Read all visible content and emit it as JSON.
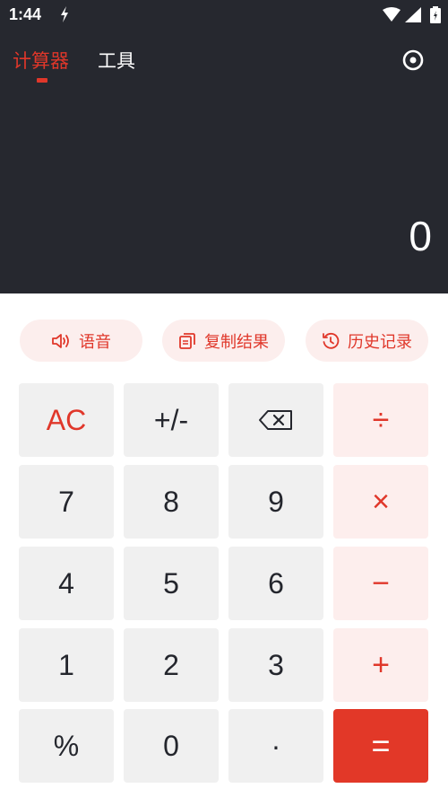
{
  "status": {
    "time": "1:44"
  },
  "tabs": {
    "calculator": "计算器",
    "tools": "工具"
  },
  "display": {
    "value": "0"
  },
  "actions": {
    "voice": "语音",
    "copy": "复制结果",
    "history": "历史记录"
  },
  "keys": {
    "ac": "AC",
    "sign": "+/-",
    "divide": "÷",
    "seven": "7",
    "eight": "8",
    "nine": "9",
    "multiply": "×",
    "four": "4",
    "five": "5",
    "six": "6",
    "minus": "−",
    "one": "1",
    "two": "2",
    "three": "3",
    "plus": "+",
    "percent": "%",
    "zero": "0",
    "dot": "·",
    "equals": "="
  },
  "colors": {
    "accent": "#e0372a",
    "dark": "#26282f"
  }
}
